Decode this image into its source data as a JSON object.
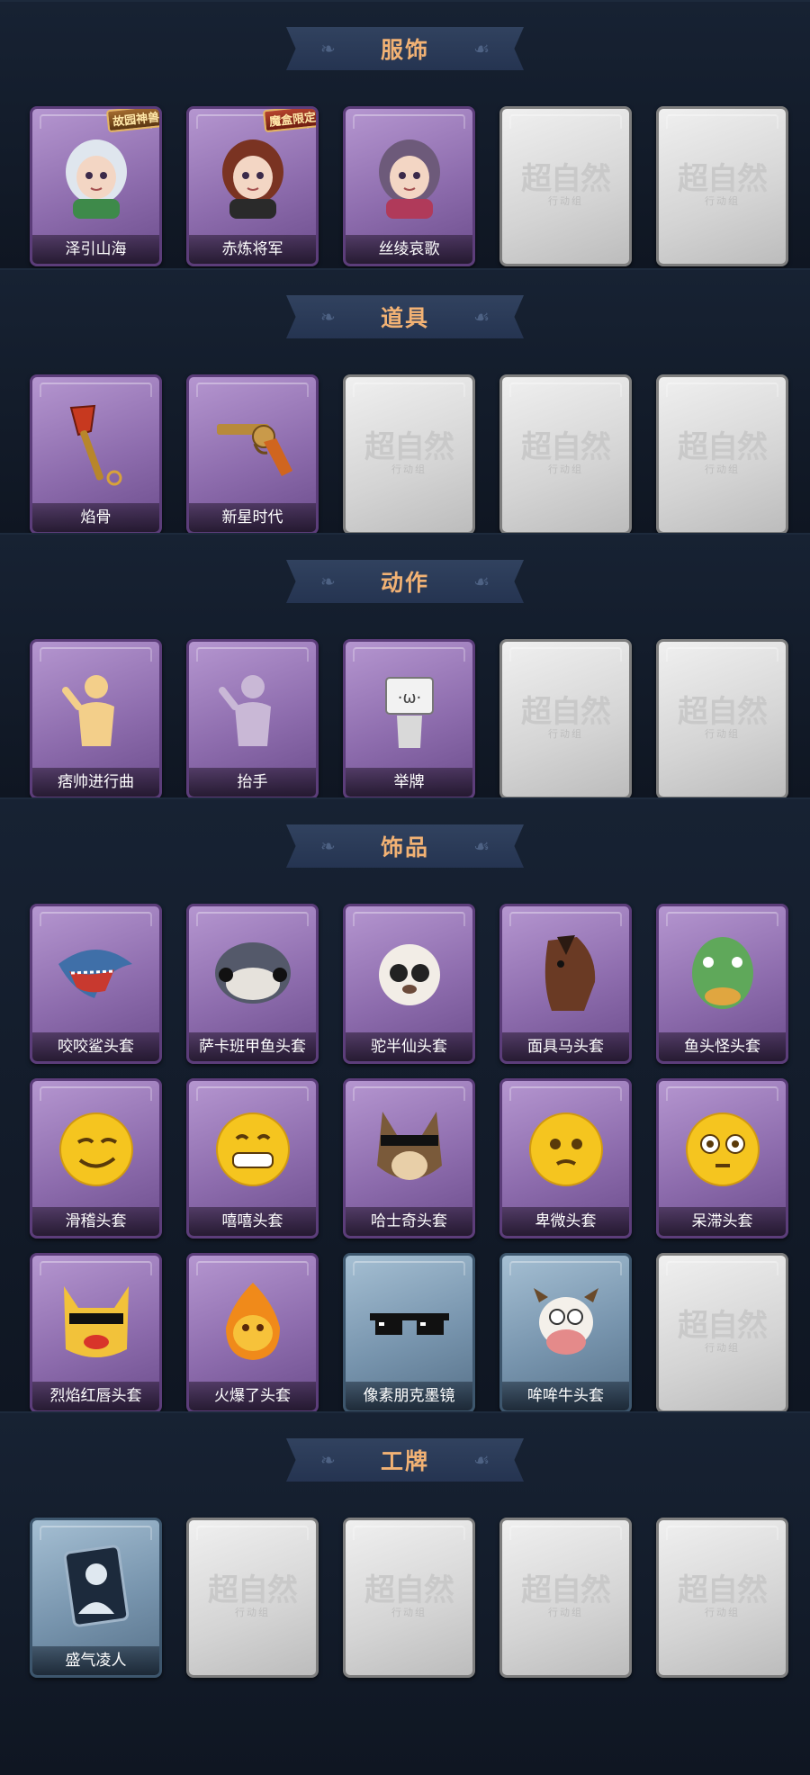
{
  "sections": [
    {
      "title": "服饰",
      "cards": [
        {
          "label": "泽引山海",
          "style": "purple",
          "icon": "character-skin-icon",
          "badge": "故园神兽"
        },
        {
          "label": "赤炼将军",
          "style": "purple",
          "icon": "character-skin-icon",
          "badge": "魔盒限定"
        },
        {
          "label": "丝绫哀歌",
          "style": "purple",
          "icon": "character-skin-icon"
        },
        {
          "label": "",
          "style": "locked",
          "icon": "locked-placeholder-icon"
        },
        {
          "label": "",
          "style": "locked",
          "icon": "locked-placeholder-icon"
        }
      ]
    },
    {
      "title": "道具",
      "cards": [
        {
          "label": "焰骨",
          "style": "purple",
          "icon": "shovel-icon"
        },
        {
          "label": "新星时代",
          "style": "purple",
          "icon": "revolver-icon"
        },
        {
          "label": "",
          "style": "locked",
          "icon": "locked-placeholder-icon"
        },
        {
          "label": "",
          "style": "locked",
          "icon": "locked-placeholder-icon"
        },
        {
          "label": "",
          "style": "locked",
          "icon": "locked-placeholder-icon"
        }
      ]
    },
    {
      "title": "动作",
      "cards": [
        {
          "label": "痞帅进行曲",
          "style": "purple",
          "icon": "pose-figure-icon"
        },
        {
          "label": "抬手",
          "style": "purple",
          "icon": "pose-figure-icon"
        },
        {
          "label": "举牌",
          "style": "purple",
          "icon": "sign-figure-icon"
        },
        {
          "label": "",
          "style": "locked",
          "icon": "locked-placeholder-icon"
        },
        {
          "label": "",
          "style": "locked",
          "icon": "locked-placeholder-icon"
        }
      ]
    },
    {
      "title": "饰品",
      "cards": [
        {
          "label": "咬咬鲨头套",
          "style": "purple",
          "icon": "shark-head-icon"
        },
        {
          "label": "萨卡班甲鱼头套",
          "style": "purple",
          "icon": "fish-head-icon"
        },
        {
          "label": "驼半仙头套",
          "style": "purple",
          "icon": "alpaca-head-icon"
        },
        {
          "label": "面具马头套",
          "style": "purple",
          "icon": "horse-head-icon"
        },
        {
          "label": "鱼头怪头套",
          "style": "purple",
          "icon": "green-fish-head-icon"
        },
        {
          "label": "滑稽头套",
          "style": "purple",
          "icon": "smirk-emoji-icon"
        },
        {
          "label": "嘻嘻头套",
          "style": "purple",
          "icon": "grin-emoji-icon"
        },
        {
          "label": "哈士奇头套",
          "style": "purple",
          "icon": "husky-head-icon"
        },
        {
          "label": "卑微头套",
          "style": "purple",
          "icon": "pleading-emoji-icon"
        },
        {
          "label": "呆滞头套",
          "style": "purple",
          "icon": "dazed-emoji-icon"
        },
        {
          "label": "烈焰红唇头套",
          "style": "purple",
          "icon": "yellow-mascot-head-icon"
        },
        {
          "label": "火爆了头套",
          "style": "purple",
          "icon": "fire-head-icon"
        },
        {
          "label": "像素朋克墨镜",
          "style": "blue",
          "icon": "pixel-sunglasses-icon"
        },
        {
          "label": "哞哞牛头套",
          "style": "blue",
          "icon": "cow-head-icon"
        },
        {
          "label": "",
          "style": "locked",
          "icon": "locked-placeholder-icon"
        }
      ]
    },
    {
      "title": "工牌",
      "cards": [
        {
          "label": "盛气凌人",
          "style": "blue",
          "icon": "badge-card-icon"
        },
        {
          "label": "",
          "style": "locked",
          "icon": "locked-placeholder-icon"
        },
        {
          "label": "",
          "style": "locked",
          "icon": "locked-placeholder-icon"
        },
        {
          "label": "",
          "style": "locked",
          "icon": "locked-placeholder-icon"
        },
        {
          "label": "",
          "style": "locked",
          "icon": "locked-placeholder-icon"
        }
      ]
    }
  ],
  "locked_text": "超自然",
  "locked_subtext": "行动组",
  "colors": {
    "background": "#111a26",
    "banner": "#2a3a58",
    "title_text": "#f2b274",
    "card_purple": "#8d6cad",
    "card_blue": "#7794ad",
    "card_locked": "#d4d4d4"
  }
}
